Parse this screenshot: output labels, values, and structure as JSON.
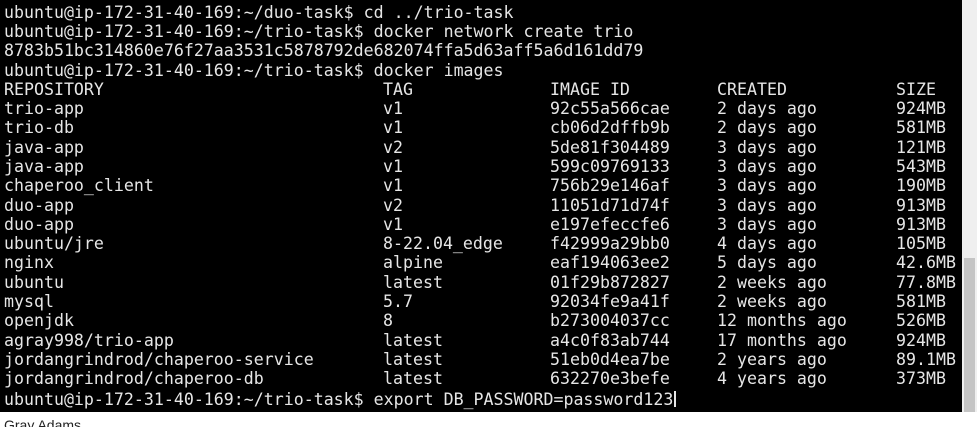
{
  "terminal": {
    "lines_before": [
      "ubuntu@ip-172-31-40-169:~/duo-task$ cd ../trio-task",
      "ubuntu@ip-172-31-40-169:~/trio-task$ docker network create trio",
      "8783b51bc314860e76f27aa3531c5878792de682074ffa5d63aff5a6d161dd79",
      "ubuntu@ip-172-31-40-169:~/trio-task$ docker images"
    ],
    "images_table": {
      "headers": [
        "REPOSITORY",
        "TAG",
        "IMAGE ID",
        "CREATED",
        "SIZE"
      ],
      "rows": [
        [
          "trio-app",
          "v1",
          "92c55a566cae",
          "2 days ago",
          "924MB"
        ],
        [
          "trio-db",
          "v1",
          "cb06d2dffb9b",
          "2 days ago",
          "581MB"
        ],
        [
          "java-app",
          "v2",
          "5de81f304489",
          "3 days ago",
          "121MB"
        ],
        [
          "java-app",
          "v1",
          "599c09769133",
          "3 days ago",
          "543MB"
        ],
        [
          "chaperoo_client",
          "v1",
          "756b29e146af",
          "3 days ago",
          "190MB"
        ],
        [
          "duo-app",
          "v2",
          "11051d71d74f",
          "3 days ago",
          "913MB"
        ],
        [
          "duo-app",
          "v1",
          "e197efeccfe6",
          "3 days ago",
          "913MB"
        ],
        [
          "ubuntu/jre",
          "8-22.04_edge",
          "f42999a29bb0",
          "4 days ago",
          "105MB"
        ],
        [
          "nginx",
          "alpine",
          "eaf194063ee2",
          "5 days ago",
          "42.6MB"
        ],
        [
          "ubuntu",
          "latest",
          "01f29b872827",
          "2 weeks ago",
          "77.8MB"
        ],
        [
          "mysql",
          "5.7",
          "92034fe9a41f",
          "2 weeks ago",
          "581MB"
        ],
        [
          "openjdk",
          "8",
          "b273004037cc",
          "12 months ago",
          "526MB"
        ],
        [
          "agray998/trio-app",
          "latest",
          "a4c0f83ab744",
          "17 months ago",
          "924MB"
        ],
        [
          "jordangrindrod/chaperoo-service",
          "latest",
          "51eb0d4ea7be",
          "2 years ago",
          "89.1MB"
        ],
        [
          "jordangrindrod/chaperoo-db",
          "latest",
          "632270e3befe",
          "4 years ago",
          "373MB"
        ]
      ]
    },
    "current_prompt": "ubuntu@ip-172-31-40-169:~/trio-task$ export DB_PASSWORD=password123"
  },
  "bottom_strip_text": "Gray Adams",
  "colors": {
    "background": "#000000",
    "foreground": "#e6e6e6",
    "scrollbar_track": "#efefef",
    "scrollbar_thumb": "#c4c4c4"
  }
}
